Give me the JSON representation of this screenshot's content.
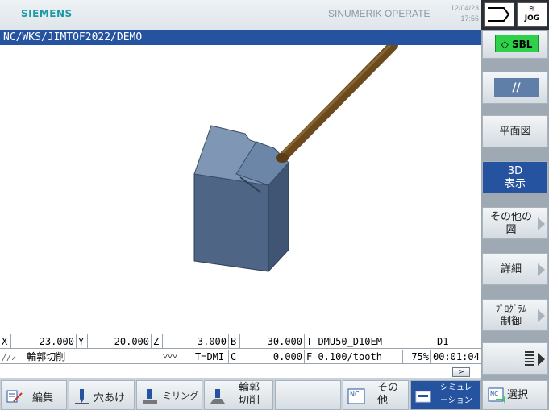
{
  "header": {
    "brand": "SIEMENS",
    "product": "SINUMERIK OPERATE",
    "date": "12/04/23",
    "time": "17:56"
  },
  "program_path": "NC/WKS/JIMTOF2022/DEMO",
  "status": {
    "x_label": "X",
    "x_value": "23.000",
    "y_label": "Y",
    "y_value": "20.000",
    "z_label": "Z",
    "z_value": "-3.000",
    "b_label": "B",
    "b_value": "30.000",
    "tool": "T DMU50_D10EM",
    "d_num": "D1",
    "block": "輪郭切削",
    "arrows": "▽▽▽",
    "t_field": "T=DMI",
    "c_label": "C",
    "c_value": "0.000",
    "feed": "F 0.100/tooth",
    "override": "75%",
    "elapsed": "00:01:04",
    "go_label": ">"
  },
  "horizontal_softkeys": [
    {
      "label": "編集",
      "icon": "edit-icon"
    },
    {
      "label": "穴あけ",
      "icon": "drill-icon"
    },
    {
      "label": "ミリング",
      "icon": "milling-icon"
    },
    {
      "label": "輪郭切削",
      "icon": "contour-icon"
    },
    {
      "label": "",
      "icon": ""
    },
    {
      "label": "",
      "icon": ""
    },
    {
      "label": "その他",
      "icon": "nc-icon"
    },
    {
      "label": "シミュレーション",
      "icon": "simulation-icon"
    }
  ],
  "right_top": {
    "mode": "JOG"
  },
  "vertical_softkeys": {
    "sbl": "SBL",
    "parallel": "//",
    "plan_view": "平面図",
    "view3d_line1": "3D",
    "view3d_line2": "表示",
    "other_views_line1": "その他の",
    "other_views_line2": "図",
    "details": "詳細",
    "program_control_line1": "ﾌﾟﾛｸﾞﾗﾑ",
    "program_control_line2": "制御",
    "select": "選択"
  },
  "colors": {
    "accent_blue": "#2553a0",
    "brand_teal": "#1c9aa3",
    "sbl_green": "#2fd14a",
    "block_face": "#4e6586",
    "tool_brown": "#6b4a1f"
  }
}
